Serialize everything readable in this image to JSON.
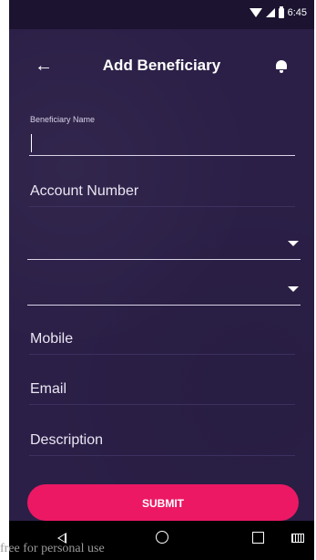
{
  "status_bar": {
    "time": "6:45"
  },
  "toolbar": {
    "title": "Add Beneficiary"
  },
  "form": {
    "beneficiary_name_label": "Beneficiary Name",
    "beneficiary_name_value": "",
    "account_number_placeholder": "Account Number",
    "dropdown_1_value": "",
    "dropdown_2_value": "",
    "mobile_placeholder": "Mobile",
    "email_placeholder": "Email",
    "description_placeholder": "Description"
  },
  "submit_label": "SUBMIT",
  "watermark": "free for personal use",
  "colors": {
    "background": "#2b1f47",
    "status_bar": "#1b1330",
    "accent": "#ec1864"
  }
}
